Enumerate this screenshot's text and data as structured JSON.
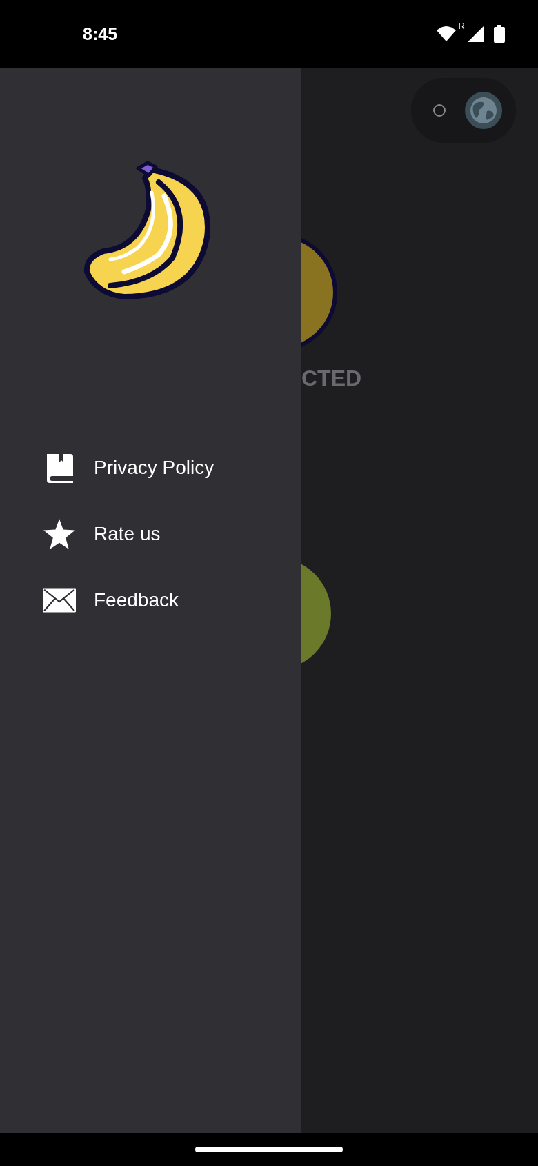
{
  "status_bar": {
    "time": "8:45",
    "network_letter": "R"
  },
  "drawer": {
    "items": [
      {
        "kind": "book",
        "label": "Privacy Policy"
      },
      {
        "kind": "star",
        "label": "Rate us"
      },
      {
        "kind": "mail",
        "label": "Feedback"
      }
    ]
  },
  "main": {
    "toggle": {
      "on": false
    },
    "status_text": "CTED"
  }
}
